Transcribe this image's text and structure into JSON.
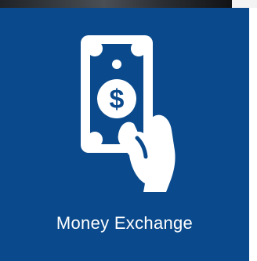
{
  "tile": {
    "label": "Money Exchange",
    "icon": "hand-holding-dollar-bill-icon",
    "background_color": "#0a4a8c",
    "foreground_color": "#ffffff"
  }
}
